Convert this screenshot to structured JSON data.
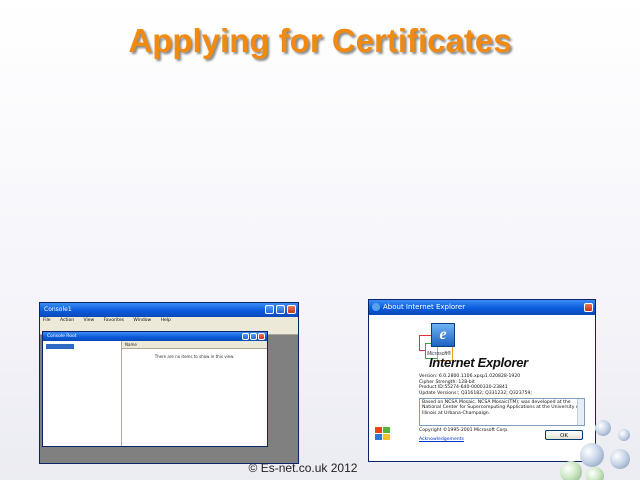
{
  "slide": {
    "title": "Applying for Certificates",
    "footer": "© Es-net.co.uk 2012"
  },
  "screenshot_left": {
    "window_title": "Console1",
    "menu": [
      "File",
      "Action",
      "View",
      "Favorites",
      "Window",
      "Help"
    ],
    "child_window_title": "Console Root",
    "tree_item": "Console Root",
    "column_header": "Name",
    "list_message": "There are no items to show in this view."
  },
  "about_ie": {
    "window_title": "About Internet Explorer",
    "brand_small": "Microsoft®",
    "product_name": "Internet Explorer",
    "info_lines": [
      "Version: 6.0.2800.1106.xpsp1.020828-1920",
      "Cipher Strength: 128-bit",
      "Product ID:55274-640-0000330-23841",
      "Update Versions:; Q316182; Q331232; Q323759;"
    ],
    "memo_text": "Based on NCSA Mosaic. NCSA Mosaic(TM); was developed at the National Center for Supercomputing Applications at the University of Illinois at Urbana-Champaign.",
    "copyright": "Copyright ©1995-2001 Microsoft Corp.",
    "acknowledgements_link": "Acknowledgements",
    "ok_label": "OK"
  }
}
